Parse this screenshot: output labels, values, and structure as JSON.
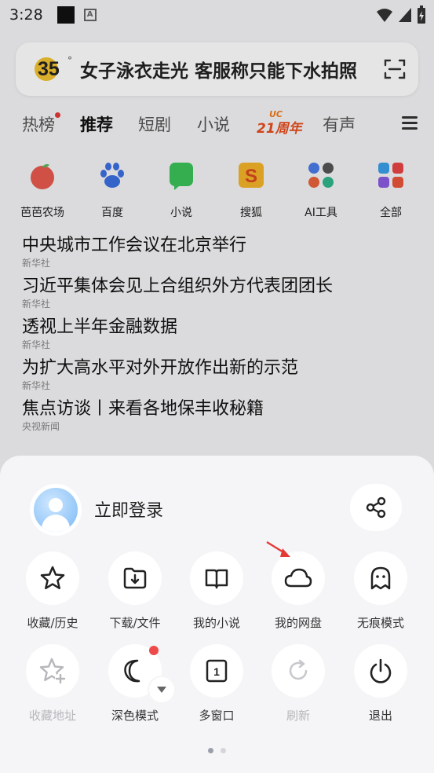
{
  "status_bar": {
    "time": "3:28"
  },
  "search": {
    "temperature": "35",
    "degree": "°",
    "query_text": "女子泳衣走光 客服称只能下水拍照"
  },
  "tabs": [
    {
      "label": "热榜"
    },
    {
      "label": "推荐"
    },
    {
      "label": "短剧"
    },
    {
      "label": "小说"
    },
    {
      "label": "UC",
      "sublabel": "21周年"
    },
    {
      "label": "有声"
    }
  ],
  "shortcuts": [
    {
      "label": "芭芭农场"
    },
    {
      "label": "百度"
    },
    {
      "label": "小说"
    },
    {
      "label": "搜狐"
    },
    {
      "label": "AI工具"
    },
    {
      "label": "全部"
    }
  ],
  "news": [
    {
      "title": "中央城市工作会议在北京举行",
      "source": "新华社"
    },
    {
      "title": "习近平集体会见上合组织外方代表团团长",
      "source": "新华社"
    },
    {
      "title": "透视上半年金融数据",
      "source": "新华社"
    },
    {
      "title": "为扩大高水平对外开放作出新的示范",
      "source": "新华社"
    },
    {
      "title": "焦点访谈丨来看各地保丰收秘籍",
      "source": "央视新闻"
    }
  ],
  "sheet": {
    "login_label": "立即登录",
    "row1": [
      {
        "label": "收藏/历史",
        "icon": "star-icon"
      },
      {
        "label": "下载/文件",
        "icon": "download-folder-icon"
      },
      {
        "label": "我的小说",
        "icon": "book-icon"
      },
      {
        "label": "我的网盘",
        "icon": "cloud-icon"
      },
      {
        "label": "无痕模式",
        "icon": "ghost-icon"
      }
    ],
    "row2": [
      {
        "label": "收藏地址",
        "icon": "star-plus-icon"
      },
      {
        "label": "深色模式",
        "icon": "moon-icon"
      },
      {
        "label": "多窗口",
        "icon": "window-icon"
      },
      {
        "label": "刷新",
        "icon": "refresh-icon"
      },
      {
        "label": "退出",
        "icon": "power-icon"
      }
    ]
  },
  "colors": {
    "accent_red": "#e53935",
    "anniversary_orange": "#e84c1c"
  }
}
